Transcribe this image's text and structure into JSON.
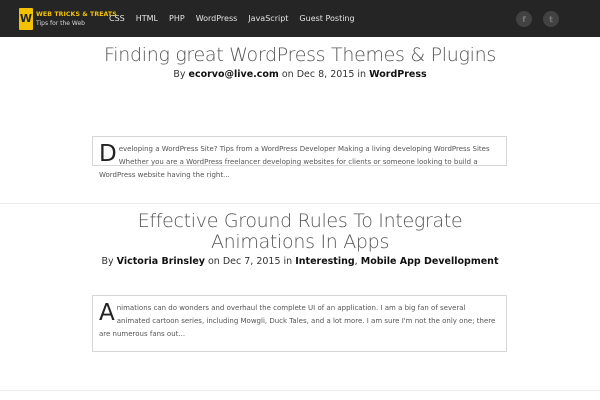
{
  "header": {
    "logo_letter": "W",
    "logo_title": "WEB TRICKS & TREATS",
    "logo_subtitle": "Tips for the Web",
    "nav": [
      "CSS",
      "HTML",
      "PHP",
      "WordPress",
      "JavaScript",
      "Guest Posting"
    ],
    "social": [
      {
        "icon": "facebook-icon",
        "glyph": "f"
      },
      {
        "icon": "twitter-icon",
        "glyph": "t"
      }
    ]
  },
  "posts": [
    {
      "title": "Finding great WordPress Themes & Plugins",
      "meta_by": "By",
      "author": "ecorvo@live.com",
      "meta_on": "on Dec 8, 2015 in",
      "categories": [
        "WordPress"
      ],
      "excerpt_dropcap": "D",
      "excerpt_text": "eveloping a WordPress Site? Tips from a WordPress Developer   Making a living developing WordPress Sites Whether you are a WordPress freelancer developing websites for clients or someone looking to build a WordPress website having the right..."
    },
    {
      "title": "Effective Ground Rules To Integrate Animations In Apps",
      "meta_by": "By",
      "author": "Victoria Brinsley",
      "meta_on": "on Dec 7, 2015 in",
      "categories": [
        "Interesting",
        "Mobile App Devellopment"
      ],
      "category_separator": ",",
      "excerpt_dropcap": "A",
      "excerpt_text": "nimations can do wonders and overhaul the complete UI of an application.   I am a big fan of several animated cartoon series, including Mowgli, Duck Tales, and a lot more. I am sure I'm not the only one; there are numerous fans out..."
    }
  ],
  "colors": {
    "topbar": "#252525",
    "logo_accent": "#f2c200",
    "nav_text": "#e3e3e3",
    "title_text": "#555555"
  }
}
